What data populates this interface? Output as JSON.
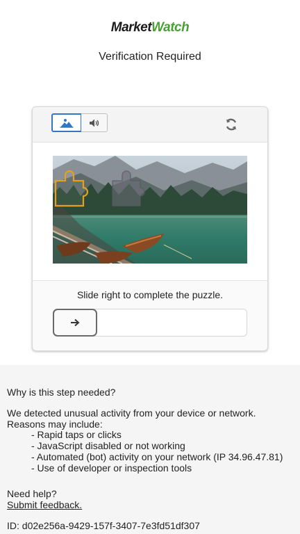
{
  "brand": {
    "logo_part1": "Market",
    "logo_part2": "Watch"
  },
  "page": {
    "title": "Verification Required"
  },
  "captcha": {
    "image_mode_icon": "image-icon",
    "audio_mode_icon": "speaker-icon",
    "refresh_icon": "refresh-icon",
    "instruction": "Slide right to complete the puzzle.",
    "handle_icon": "arrow-right-icon",
    "accent_color": "#2f78c4",
    "puzzle_outline_color": "#e6a11c"
  },
  "info": {
    "question": "Why is this step needed?",
    "paragraph_line1": "We detected unusual activity from your device or network.",
    "paragraph_line2": "Reasons may include:",
    "reasons": [
      "- Rapid taps or clicks",
      "- JavaScript disabled or not working",
      "- Automated (bot) activity on your network (IP 34.96.47.81)",
      "- Use of developer or inspection tools"
    ],
    "need_help": "Need help?",
    "feedback_link": "Submit feedback.",
    "id_text": "ID: d02e256a-9429-157f-3407-7e3fd51df307"
  }
}
